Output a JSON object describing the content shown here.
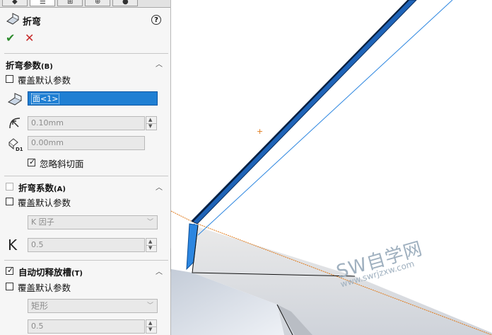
{
  "panel": {
    "title": "折弯",
    "help": "?",
    "confirm_glyph": "✔",
    "cancel_glyph": "✕",
    "bend_params": {
      "title": "折弯参数",
      "title_key": "(B)",
      "override_label": "覆盖默认参数",
      "face_value": "面<1>",
      "radius_value": "0.10mm",
      "depth_value": "0.00mm",
      "depth_icon_text": "D1",
      "ignore_bevel_label": "忽略斜切面"
    },
    "bend_allowance": {
      "title": "折弯系数",
      "title_key": "(A)",
      "override_label": "覆盖默认参数",
      "type_value": "K 因子",
      "k_icon": "K",
      "k_value": "0.5"
    },
    "auto_relief": {
      "title": "自动切释放槽",
      "title_key": "(T)",
      "override_label": "覆盖默认参数",
      "type_value": "矩形",
      "ratio_value": "0.5"
    }
  },
  "viewport": {
    "watermark_main": "SW自学网",
    "watermark_url": "www.swrjzxw.com",
    "origin_marker": "+"
  },
  "colors": {
    "selection": "#1f7fd3",
    "edge_orange": "#e07a1a",
    "edge_blue": "#2c86e0",
    "ok_green": "#2e8b2e",
    "cancel_red": "#c62828"
  }
}
